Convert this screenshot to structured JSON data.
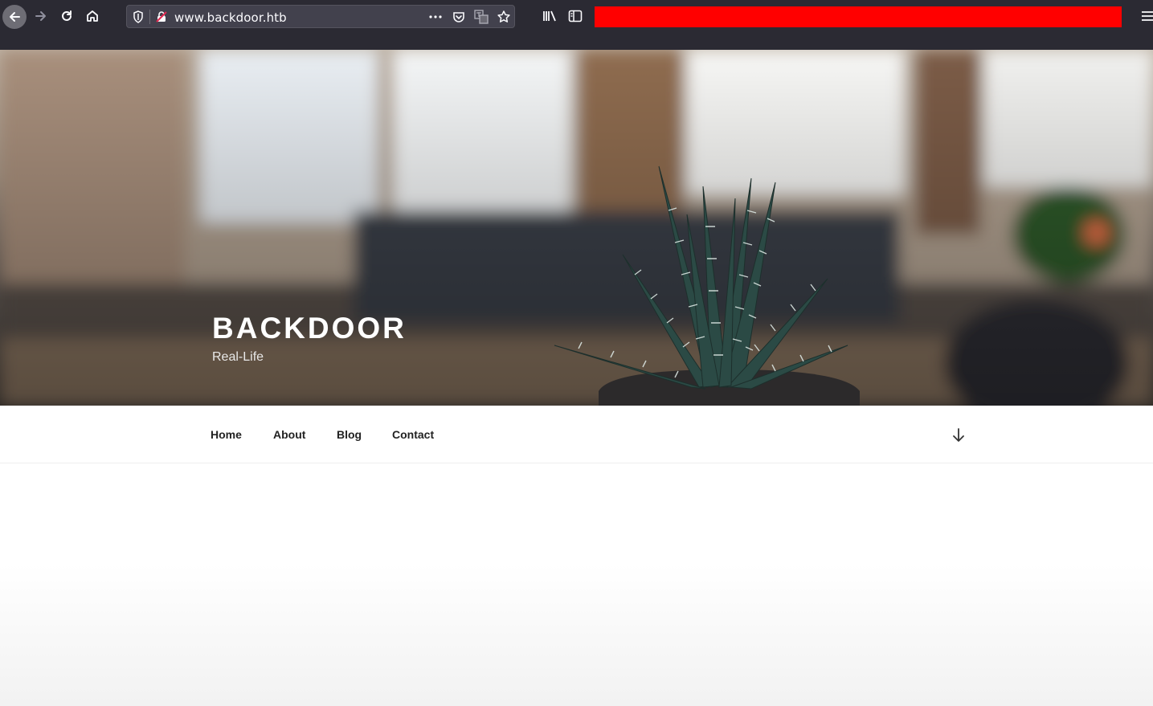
{
  "browser": {
    "url": "www.backdoor.htb",
    "icons": [
      "back-arrow-icon",
      "forward-arrow-icon",
      "reload-icon",
      "home-icon",
      "shield-icon",
      "insecure-lock-icon",
      "more-dots-icon",
      "pocket-icon",
      "translate-icon",
      "bookmark-star-icon",
      "library-icon",
      "sidebar-icon",
      "hamburger-menu-icon"
    ],
    "redaction_color": "#ff0000"
  },
  "site": {
    "title": "BACKDOOR",
    "tagline": "Real-Life"
  },
  "nav": {
    "items": [
      {
        "label": "Home"
      },
      {
        "label": "About"
      },
      {
        "label": "Blog"
      },
      {
        "label": "Contact"
      }
    ],
    "scroll_icon": "arrow-down-icon"
  }
}
